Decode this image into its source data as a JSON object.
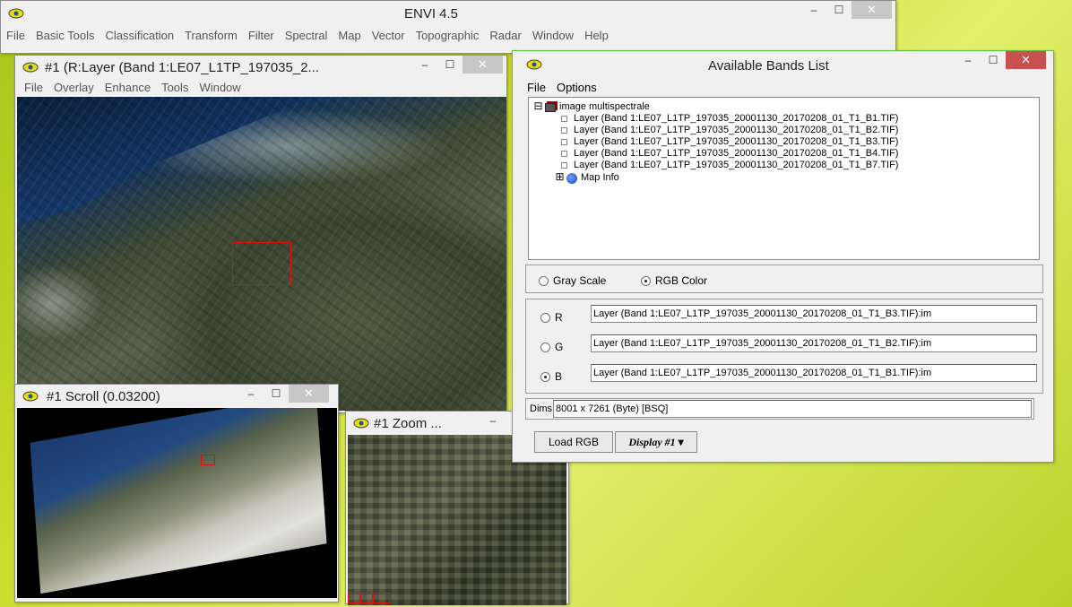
{
  "main_window": {
    "title": "ENVI 4.5",
    "menu": [
      "File",
      "Basic Tools",
      "Classification",
      "Transform",
      "Filter",
      "Spectral",
      "Map",
      "Vector",
      "Topographic",
      "Radar",
      "Window",
      "Help"
    ],
    "controls": {
      "minimize": "–",
      "maximize": "☐",
      "close": "✕"
    }
  },
  "image_window": {
    "title": "#1 (R:Layer (Band 1:LE07_L1TP_197035_2...",
    "menu": [
      "File",
      "Overlay",
      "Enhance",
      "Tools",
      "Window"
    ],
    "controls": {
      "minimize": "–",
      "maximize": "☐",
      "close": "✕"
    }
  },
  "scroll_window": {
    "title": "#1 Scroll (0.03200)",
    "controls": {
      "minimize": "–",
      "maximize": "☐",
      "close": "✕"
    }
  },
  "zoom_window": {
    "title": "#1 Zoom ...",
    "controls": {
      "minimize": "–"
    }
  },
  "bands_window": {
    "title": "Available Bands List",
    "menu": [
      "File",
      "Options"
    ],
    "controls": {
      "minimize": "–",
      "maximize": "☐",
      "close": "✕"
    },
    "tree": {
      "root": "image multispectrale",
      "bands": [
        "Layer (Band 1:LE07_L1TP_197035_20001130_20170208_01_T1_B1.TIF)",
        "Layer (Band 1:LE07_L1TP_197035_20001130_20170208_01_T1_B2.TIF)",
        "Layer (Band 1:LE07_L1TP_197035_20001130_20170208_01_T1_B3.TIF)",
        "Layer (Band 1:LE07_L1TP_197035_20001130_20170208_01_T1_B4.TIF)",
        "Layer (Band 1:LE07_L1TP_197035_20001130_20170208_01_T1_B7.TIF)"
      ],
      "map_info": "Map Info",
      "root_expander": "⊟",
      "map_expander": "⊞"
    },
    "mode": {
      "gray": "Gray Scale",
      "rgb": "RGB Color",
      "selected": "rgb"
    },
    "channels": {
      "r_label": "R",
      "g_label": "G",
      "b_label": "B",
      "r_value": "Layer (Band 1:LE07_L1TP_197035_20001130_20170208_01_T1_B3.TIF):im",
      "g_value": "Layer (Band 1:LE07_L1TP_197035_20001130_20170208_01_T1_B2.TIF):im",
      "b_value": "Layer (Band 1:LE07_L1TP_197035_20001130_20170208_01_T1_B1.TIF):im",
      "selected": "b"
    },
    "dims_label": "Dims",
    "dims_value": "8001 x 7261 (Byte) [BSQ]",
    "load_button": "Load RGB",
    "display_button": "Display #1",
    "display_arrow": "▾"
  },
  "colors": {
    "accent_roi": "#e01010",
    "close_active": "#c75050"
  }
}
